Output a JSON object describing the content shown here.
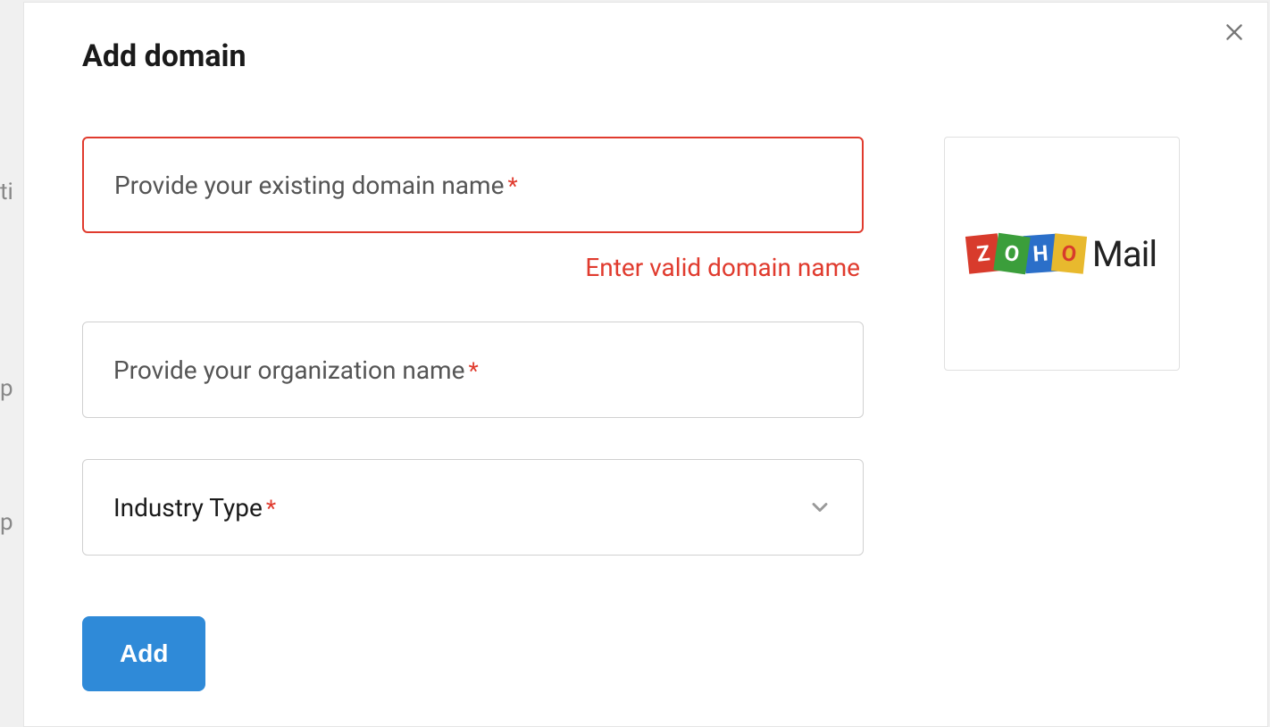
{
  "modal": {
    "title": "Add domain",
    "domain_field": {
      "placeholder": "Provide your existing domain name",
      "required_mark": "*",
      "error": "Enter valid domain name"
    },
    "org_field": {
      "placeholder": "Provide your organization name",
      "required_mark": "*"
    },
    "industry_field": {
      "placeholder": "Industry Type",
      "required_mark": "*"
    },
    "add_button": "Add",
    "logo": {
      "z": "Z",
      "o1": "O",
      "h": "H",
      "o2": "O",
      "mail": "Mail"
    }
  }
}
